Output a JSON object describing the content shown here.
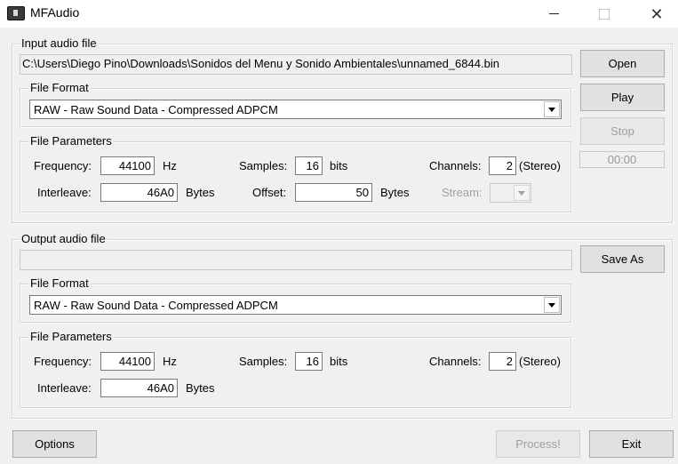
{
  "window": {
    "title": "MFAudio",
    "controls": {
      "minimize": "—",
      "maximize": "☐",
      "close": "✕"
    }
  },
  "input": {
    "group_label": "Input audio file",
    "path": "C:\\Users\\Diego Pino\\Downloads\\Sonidos del Menu y Sonido Ambientales\\unnamed_6844.bin",
    "format": {
      "group_label": "File Format",
      "value": "RAW - Raw Sound Data - Compressed ADPCM"
    },
    "params": {
      "group_label": "File Parameters",
      "frequency_label": "Frequency:",
      "frequency": "44100",
      "frequency_unit": "Hz",
      "samples_label": "Samples:",
      "samples": "16",
      "samples_unit": "bits",
      "channels_label": "Channels:",
      "channels": "2",
      "channels_note": "(Stereo)",
      "interleave_label": "Interleave:",
      "interleave": "46A0",
      "interleave_unit": "Bytes",
      "offset_label": "Offset:",
      "offset": "50",
      "offset_unit": "Bytes",
      "stream_label": "Stream:"
    }
  },
  "output": {
    "group_label": "Output audio file",
    "path": "",
    "format": {
      "group_label": "File Format",
      "value": "RAW - Raw Sound Data - Compressed ADPCM"
    },
    "params": {
      "group_label": "File Parameters",
      "frequency_label": "Frequency:",
      "frequency": "44100",
      "frequency_unit": "Hz",
      "samples_label": "Samples:",
      "samples": "16",
      "samples_unit": "bits",
      "channels_label": "Channels:",
      "channels": "2",
      "channels_note": "(Stereo)",
      "interleave_label": "Interleave:",
      "interleave": "46A0",
      "interleave_unit": "Bytes"
    }
  },
  "buttons": {
    "open": "Open",
    "play": "Play",
    "stop": "Stop",
    "time": "00:00",
    "save_as": "Save As",
    "options": "Options",
    "process": "Process!",
    "exit": "Exit"
  }
}
